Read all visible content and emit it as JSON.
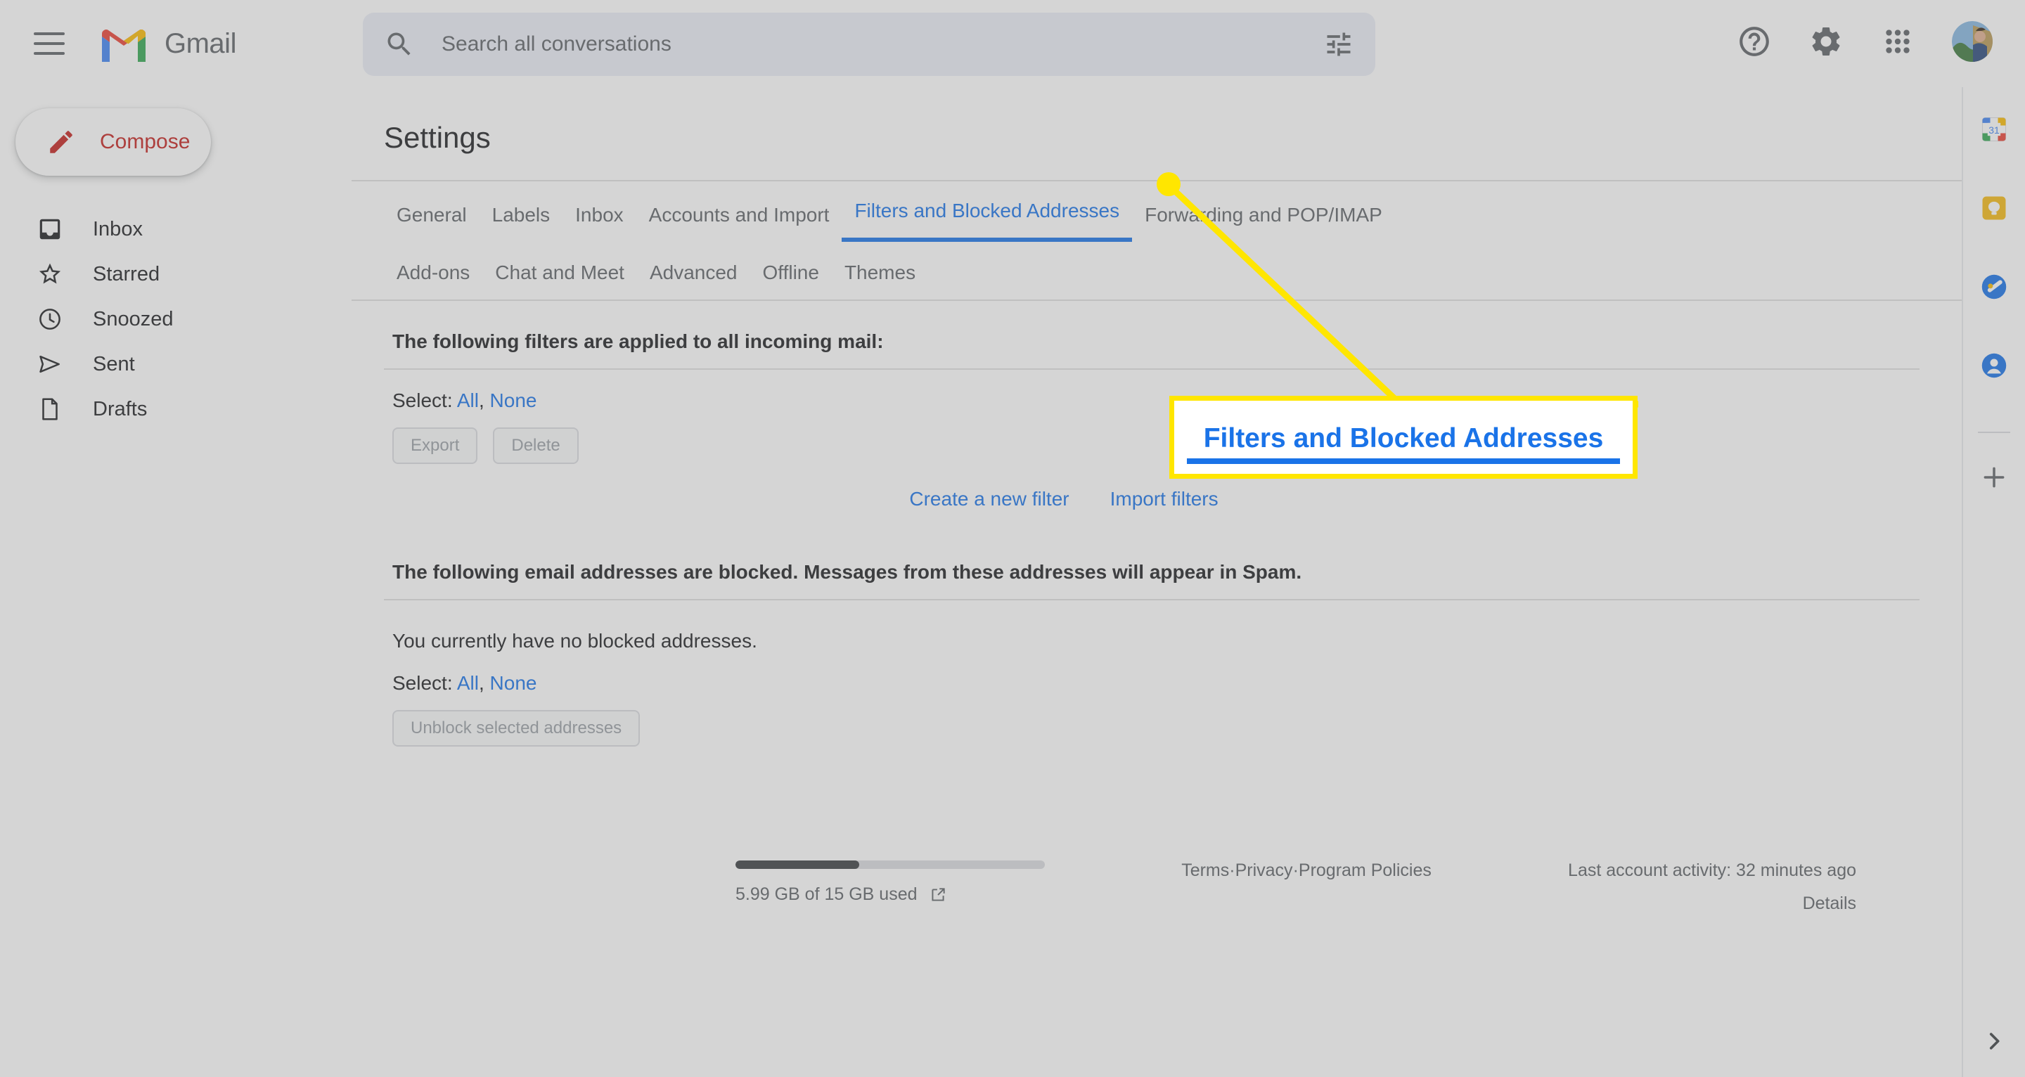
{
  "app": {
    "brand": "Gmail",
    "menu_icon": "hamburger-icon"
  },
  "search": {
    "placeholder": "Search all conversations",
    "value": "",
    "icon": "search-icon",
    "options_icon": "tune-icon"
  },
  "topbar_actions": [
    {
      "name": "help-icon",
      "label": "Support"
    },
    {
      "name": "gear-icon",
      "label": "Settings"
    },
    {
      "name": "apps-grid-icon",
      "label": "Google apps"
    },
    {
      "name": "avatar",
      "label": "Google Account"
    }
  ],
  "sidebar": {
    "compose": {
      "label": "Compose",
      "icon": "pencil-icon"
    },
    "items": [
      {
        "label": "Inbox",
        "icon": "inbox-icon"
      },
      {
        "label": "Starred",
        "icon": "star-icon"
      },
      {
        "label": "Snoozed",
        "icon": "clock-icon"
      },
      {
        "label": "Sent",
        "icon": "send-icon"
      },
      {
        "label": "Drafts",
        "icon": "draft-icon"
      }
    ]
  },
  "settings": {
    "title": "Settings",
    "tabs_row1": [
      {
        "label": "General",
        "active": false
      },
      {
        "label": "Labels",
        "active": false
      },
      {
        "label": "Inbox",
        "active": false
      },
      {
        "label": "Accounts and Import",
        "active": false
      },
      {
        "label": "Filters and Blocked Addresses",
        "active": true
      },
      {
        "label": "Forwarding and POP/IMAP",
        "active": false
      }
    ],
    "tabs_row2": [
      {
        "label": "Add-ons",
        "active": false
      },
      {
        "label": "Chat and Meet",
        "active": false
      },
      {
        "label": "Advanced",
        "active": false
      },
      {
        "label": "Offline",
        "active": false
      },
      {
        "label": "Themes",
        "active": false
      }
    ],
    "filters_section": {
      "heading": "The following filters are applied to all incoming mail:",
      "select_label": "Select:",
      "select_all": "All",
      "select_separator": ",",
      "select_none": "None",
      "buttons": [
        {
          "label": "Export",
          "disabled": true
        },
        {
          "label": "Delete",
          "disabled": true
        }
      ],
      "actions": [
        {
          "label": "Create a new filter"
        },
        {
          "label": "Import filters"
        }
      ]
    },
    "blocked_section": {
      "heading": "The following email addresses are blocked. Messages from these addresses will appear in Spam.",
      "empty_message": "You currently have no blocked addresses.",
      "select_label": "Select:",
      "select_all": "All",
      "select_separator": ",",
      "select_none": "None",
      "buttons": [
        {
          "label": "Unblock selected addresses",
          "disabled": true
        }
      ]
    }
  },
  "footer": {
    "storage_used_text": "5.99 GB of 15 GB used",
    "storage_percent": 40,
    "storage_link_icon": "external-link-icon",
    "legal": [
      {
        "label": "Terms"
      },
      {
        "label": "Privacy"
      },
      {
        "label": "Program Policies"
      }
    ],
    "legal_separator": " · ",
    "activity": "Last account activity: 32 minutes ago",
    "details_label": "Details"
  },
  "right_rail": {
    "icons": [
      {
        "name": "google-calendar-icon",
        "label": "Calendar",
        "badge": "31"
      },
      {
        "name": "google-keep-icon",
        "label": "Keep"
      },
      {
        "name": "google-tasks-icon",
        "label": "Tasks"
      },
      {
        "name": "google-contacts-icon",
        "label": "Contacts"
      }
    ],
    "add_label": "Get add-ons",
    "add_icon": "plus-icon",
    "expand_icon": "chevron-right-icon"
  },
  "annotation": {
    "callout_text": "Filters and Blocked Addresses",
    "callout_border_color": "#ffe600",
    "callout_text_color": "#1a73e8",
    "pointer_color": "#ffe600"
  },
  "colors": {
    "accent_blue": "#1a73e8",
    "compose_red": "#c5221f",
    "text_primary": "#202124",
    "text_secondary": "#5f6368",
    "divider": "#e0e0e0",
    "highlight_yellow": "#ffe600"
  }
}
